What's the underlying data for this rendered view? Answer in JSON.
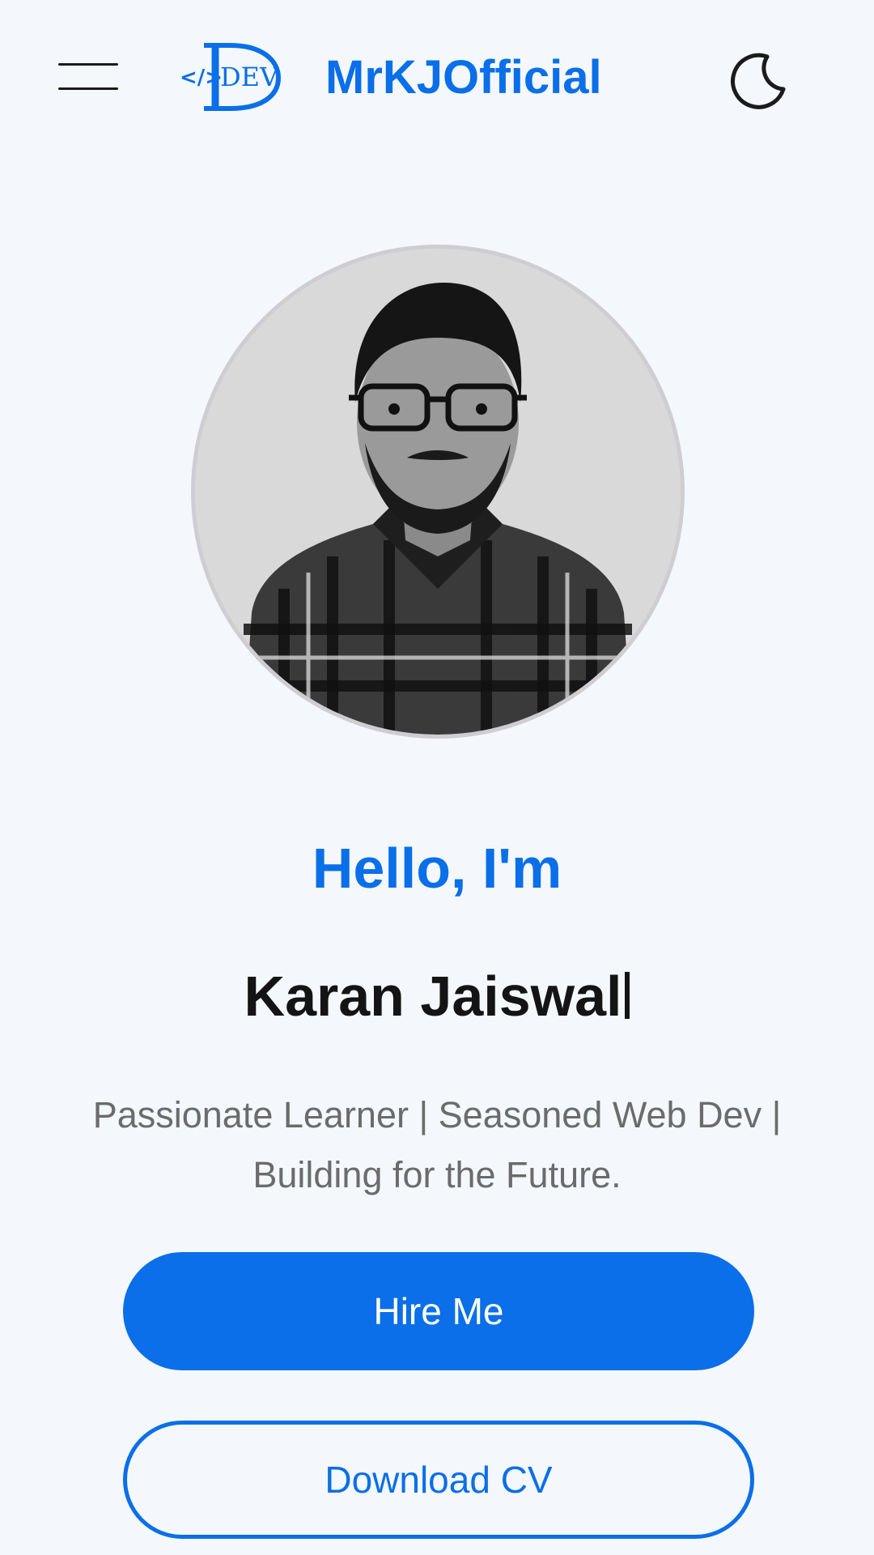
{
  "header": {
    "menu_icon": "hamburger-menu-icon",
    "logo_text": "DEV",
    "logo_code_glyph": "</>",
    "brand_name": "MrKJOfficial",
    "theme_icon": "moon-icon"
  },
  "hero": {
    "avatar_alt": "Karan Jaiswal portrait",
    "greeting": "Hello, I'm",
    "name": "Karan Jaiswal",
    "tagline": "Passionate Learner | Seasoned Web Dev | Building for the Future."
  },
  "actions": {
    "hire_label": "Hire Me",
    "cv_label": "Download CV"
  },
  "colors": {
    "accent": "#0a6fe8",
    "background": "#f4f8fc",
    "text_dark": "#141414",
    "text_muted": "#6b6b6b"
  }
}
